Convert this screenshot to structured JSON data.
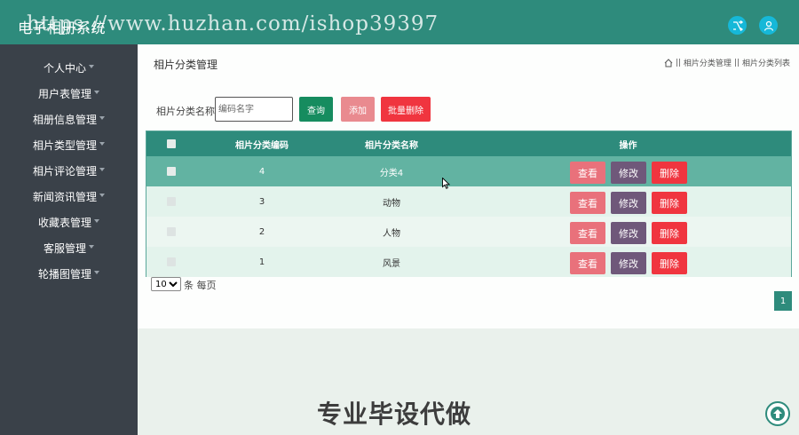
{
  "app": {
    "title": "电子相册系统",
    "watermark": "https://www.huzhan.com/ishop39397"
  },
  "sidebar": {
    "items": [
      {
        "label": "个人中心",
        "caret": true
      },
      {
        "label": "用户表管理",
        "caret": true
      },
      {
        "label": "相册信息管理",
        "caret": true
      },
      {
        "label": "相片类型管理",
        "caret": true
      },
      {
        "label": "相片评论管理",
        "caret": true
      },
      {
        "label": "新闻资讯管理",
        "caret": true
      },
      {
        "label": "收藏表管理",
        "caret": true
      },
      {
        "label": "客服管理",
        "caret": true
      },
      {
        "label": "轮播图管理",
        "caret": true
      }
    ]
  },
  "page": {
    "title": "相片分类管理",
    "breadcrumb": [
      "相片分类管理",
      "相片分类列表"
    ],
    "breadcrumb_sep": "||"
  },
  "search": {
    "label": "相片分类名称",
    "placeholder": "编码名字",
    "query_label": "查询",
    "add_label": "添加",
    "bulk_delete_label": "批量删除"
  },
  "table": {
    "columns": [
      "相片分类编码",
      "相片分类名称",
      "操作"
    ],
    "rows": [
      {
        "code": "4",
        "name": "分类4"
      },
      {
        "code": "3",
        "name": "动物"
      },
      {
        "code": "2",
        "name": "人物"
      },
      {
        "code": "1",
        "name": "风景"
      }
    ],
    "actions": {
      "view": "查看",
      "edit": "修改",
      "delete": "删除"
    },
    "row_colors": [
      "#62b3a2",
      "#e3f3ec",
      "#ecf6f1",
      "#e3f3ec"
    ]
  },
  "pagination": {
    "per_page_value": "10",
    "per_page_options": [
      "10"
    ],
    "per_page_label": "条 每页",
    "current_page": "1"
  },
  "promo": {
    "text": "专业毕设代做"
  },
  "colors": {
    "primary": "#2e8b7c",
    "sidebar": "#3a4149",
    "danger": "#f0353f",
    "query": "#168c5f",
    "add": "#e98a8f",
    "edit": "#6f587a",
    "view": "#e9717b"
  },
  "icons": {
    "fullscreen": "shuffle-icon",
    "user": "user-icon",
    "home": "home-icon",
    "scroll_top": "arrow-up-icon"
  }
}
